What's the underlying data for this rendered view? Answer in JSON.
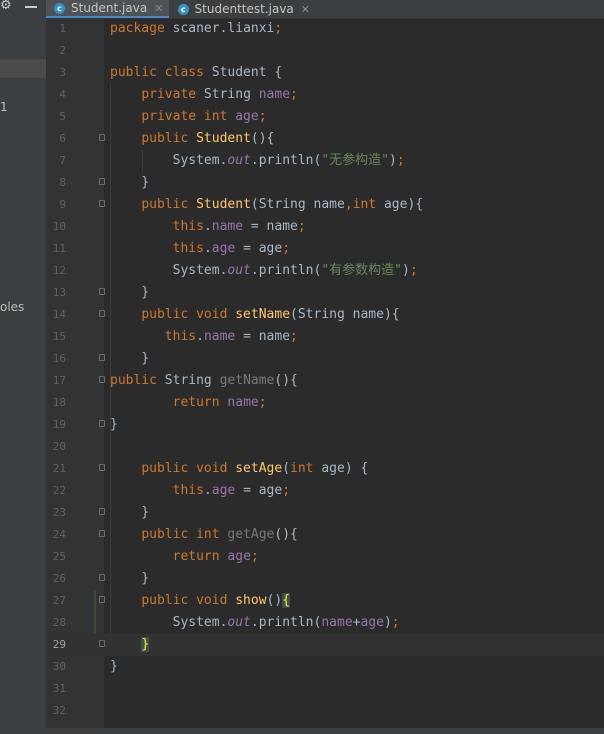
{
  "left_panel": {
    "fragments": [
      "1",
      "oles"
    ]
  },
  "tabs": [
    {
      "label": "Student.java",
      "icon": "c-class-icon",
      "active": true
    },
    {
      "label": "Studenttest.java",
      "icon": "c-class-icon",
      "active": false
    }
  ],
  "editor": {
    "current_line": 29,
    "lines": [
      {
        "n": "1",
        "html": "<span class=\"kw\">package</span> scaner.lianxi<span class=\"kw\">;</span>"
      },
      {
        "n": "2",
        "html": ""
      },
      {
        "n": "3",
        "html": "<span class=\"kw\">public class</span> Student {"
      },
      {
        "n": "4",
        "html": "    <span class=\"kw\">private</span> String <span class=\"fld\">name</span><span class=\"kw\">;</span>"
      },
      {
        "n": "5",
        "html": "    <span class=\"kw\">private int</span> <span class=\"fld\">age</span><span class=\"kw\">;</span>"
      },
      {
        "n": "6",
        "html": "    <span class=\"kw\">public</span> <span class=\"fn\">Student</span>(){",
        "fold": true
      },
      {
        "n": "7",
        "html": "        System.<span class=\"sfld\">out</span>.println(<span class=\"str\">\"无参构造\"</span>)<span class=\"kw\">;</span>"
      },
      {
        "n": "8",
        "html": "    }",
        "fold": true
      },
      {
        "n": "9",
        "html": "    <span class=\"kw\">public</span> <span class=\"fn\">Student</span>(String name<span class=\"kw\">,int</span> age){",
        "fold": true
      },
      {
        "n": "10",
        "html": "        <span class=\"kw\">this</span>.<span class=\"fld\">name</span> = name<span class=\"kw\">;</span>"
      },
      {
        "n": "11",
        "html": "        <span class=\"kw\">this</span>.<span class=\"fld\">age</span> = age<span class=\"kw\">;</span>"
      },
      {
        "n": "12",
        "html": "        System.<span class=\"sfld\">out</span>.println(<span class=\"str\">\"有参数构造\"</span>)<span class=\"kw\">;</span>"
      },
      {
        "n": "13",
        "html": "    }",
        "fold": true
      },
      {
        "n": "14",
        "html": "    <span class=\"kw\">public void</span> <span class=\"fn\">setName</span>(String name){",
        "fold": true
      },
      {
        "n": "15",
        "html": "       <span class=\"kw\">this</span>.<span class=\"fld\">name</span> = name<span class=\"kw\">;</span>"
      },
      {
        "n": "16",
        "html": "    }",
        "fold": true
      },
      {
        "n": "17",
        "html": "<span class=\"kw\">public</span> String <span class=\"gray\">getName</span>(){",
        "fold": true
      },
      {
        "n": "18",
        "html": "        <span class=\"kw\">return</span> <span class=\"fld\">name</span><span class=\"kw\">;</span>"
      },
      {
        "n": "19",
        "html": "}",
        "fold": true
      },
      {
        "n": "20",
        "html": ""
      },
      {
        "n": "21",
        "html": "    <span class=\"kw\">public void</span> <span class=\"fn\">setAge</span>(<span class=\"kw\">int</span> age) {",
        "fold": true
      },
      {
        "n": "22",
        "html": "        <span class=\"kw\">this</span>.<span class=\"fld\">age</span> = age<span class=\"kw\">;</span>"
      },
      {
        "n": "23",
        "html": "    }",
        "fold": true
      },
      {
        "n": "24",
        "html": "    <span class=\"kw\">public int</span> <span class=\"gray\">getAge</span>(){",
        "fold": true
      },
      {
        "n": "25",
        "html": "        <span class=\"kw\">return</span> <span class=\"fld\">age</span><span class=\"kw\">;</span>"
      },
      {
        "n": "26",
        "html": "    }",
        "fold": true
      },
      {
        "n": "27",
        "html": "    <span class=\"kw\">public void</span> <span class=\"fn\">show</span>()<span class=\"hl\">{</span>",
        "fold": true
      },
      {
        "n": "28",
        "html": "        System.<span class=\"sfld\">out</span>.println(<span class=\"fld\">name</span>+<span class=\"fld\">age</span>)<span class=\"kw\">;</span>"
      },
      {
        "n": "29",
        "html": "    <span class=\"hl\">}</span>",
        "fold": true
      },
      {
        "n": "30",
        "html": "}"
      },
      {
        "n": "31",
        "html": ""
      },
      {
        "n": "32",
        "html": ""
      }
    ]
  }
}
